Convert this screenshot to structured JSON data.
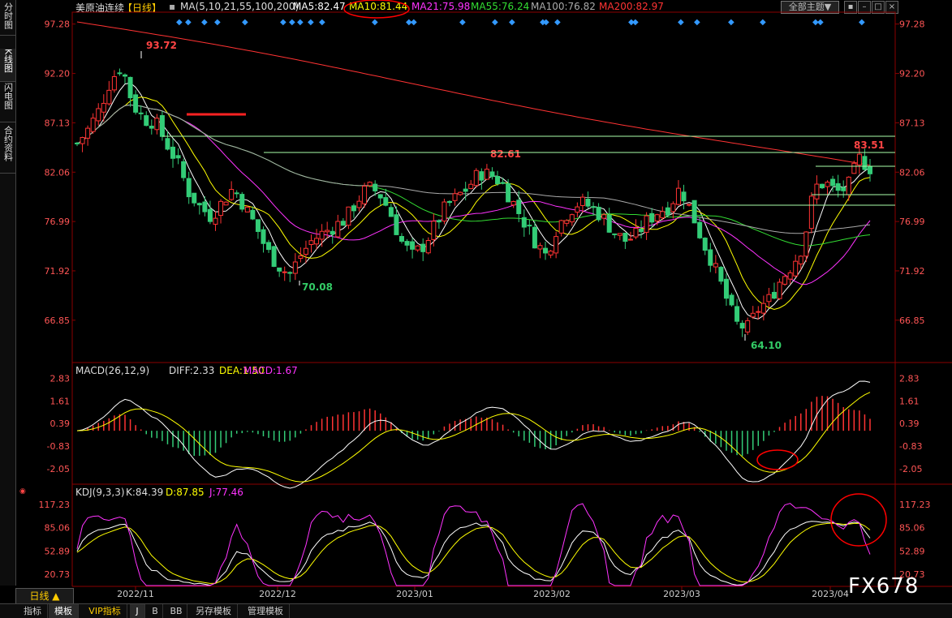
{
  "left_tabs": [
    "分时图",
    "K线图",
    "闪电图",
    "合约资料"
  ],
  "header": {
    "instrument": "美原油连续",
    "period": "【日线】",
    "ma_prefix": "MA(5,10,21,55,100,200)",
    "ma": [
      {
        "label": "MA5:82.47",
        "color": "#ffffff"
      },
      {
        "label": "MA10:81.44",
        "color": "#ffff00"
      },
      {
        "label": "MA21:75.98",
        "color": "#ff33ff"
      },
      {
        "label": "MA55:76.24",
        "color": "#33dd33"
      },
      {
        "label": "MA100:76.82",
        "color": "#aaaaaa"
      },
      {
        "label": "MA200:82.97",
        "color": "#ff3333"
      }
    ],
    "theme_button": "全部主题▼"
  },
  "price_axis": [
    "97.28",
    "92.20",
    "87.13",
    "82.06",
    "76.99",
    "71.92",
    "66.85"
  ],
  "price_annotations": [
    {
      "text": "93.72",
      "color": "#ff4444"
    },
    {
      "text": "70.08",
      "color": "#33cc66"
    },
    {
      "text": "82.61",
      "color": "#ff4444"
    },
    {
      "text": "64.10",
      "color": "#33cc66"
    },
    {
      "text": "83.51",
      "color": "#ff4444"
    }
  ],
  "macd": {
    "title": "MACD(26,12,9)",
    "diff": "DIFF:2.33",
    "dea": "DEA:1.50",
    "macd": "MACD:1.67",
    "axis": [
      "2.83",
      "1.61",
      "0.39",
      "-0.83",
      "-2.05"
    ]
  },
  "kdj": {
    "title": "KDJ(9,3,3)",
    "k": "K:84.39",
    "d": "D:87.85",
    "j": "J:77.46",
    "axis": [
      "117.23",
      "85.06",
      "52.89",
      "20.73"
    ]
  },
  "dates": [
    "2022/11",
    "2022/12",
    "2023/01",
    "2023/02",
    "2023/03",
    "2023/04"
  ],
  "period_ribbon": "日线 ▲",
  "bottom_tabs": [
    "指标",
    "模板",
    "VIP指标",
    "J",
    "B",
    "BB",
    "另存模板",
    "管理模板"
  ],
  "watermark": "FX678",
  "chart_data": {
    "type": "candlestick",
    "title": "美原油连续【日线】",
    "y_axis_ticks": [
      97.28,
      92.2,
      87.13,
      82.06,
      76.99,
      71.92,
      66.85
    ],
    "ylim": [
      62.5,
      98.5
    ],
    "x_ticks": [
      "2022/11",
      "2022/12",
      "2023/01",
      "2023/02",
      "2023/03",
      "2023/04"
    ],
    "labels": [
      {
        "text": "93.72"
      },
      {
        "text": "70.08"
      },
      {
        "text": "82.61"
      },
      {
        "text": "64.10"
      },
      {
        "text": "83.51"
      }
    ],
    "close_path": [
      85.0,
      86.5,
      88.5,
      91.5,
      93.0,
      89.0,
      87.5,
      87.2,
      85.0,
      83.0,
      80.0,
      78.5,
      77.5,
      79.0,
      80.5,
      78.5,
      76.5,
      74.0,
      72.5,
      71.5,
      73.5,
      75.0,
      75.8,
      76.5,
      77.2,
      79.0,
      80.5,
      80.0,
      78.0,
      75.0,
      73.5,
      74.5,
      76.5,
      78.5,
      79.5,
      80.5,
      82.0,
      81.8,
      81.0,
      79.0,
      77.0,
      75.0,
      73.5,
      76.5,
      78.0,
      79.0,
      78.5,
      77.5,
      76.0,
      75.0,
      75.5,
      77.0,
      78.0,
      78.5,
      80.5,
      78.0,
      75.0,
      72.5,
      69.5,
      66.5,
      66.0,
      68.0,
      69.0,
      71.0,
      72.5,
      74.5,
      80.5,
      81.0,
      80.0,
      80.5,
      83.5,
      82.5
    ],
    "macd": {
      "diff": 2.33,
      "dea": 1.5,
      "macd": 1.67,
      "ylim": [
        -2.8,
        2.9
      ]
    },
    "kdj": {
      "k": 84.39,
      "d": 87.85,
      "j": 77.46,
      "ylim": [
        5,
        125
      ]
    },
    "legend": [
      {
        "name": "MA5",
        "value": 82.47,
        "color": "#ffffff"
      },
      {
        "name": "MA10",
        "value": 81.44,
        "color": "#ffff00"
      },
      {
        "name": "MA21",
        "value": 75.98,
        "color": "#ff33ff"
      },
      {
        "name": "MA55",
        "value": 76.24,
        "color": "#33dd33"
      },
      {
        "name": "MA100",
        "value": 76.82,
        "color": "#aaaaaa"
      },
      {
        "name": "MA200",
        "value": 82.97,
        "color": "#ff3333"
      }
    ]
  }
}
